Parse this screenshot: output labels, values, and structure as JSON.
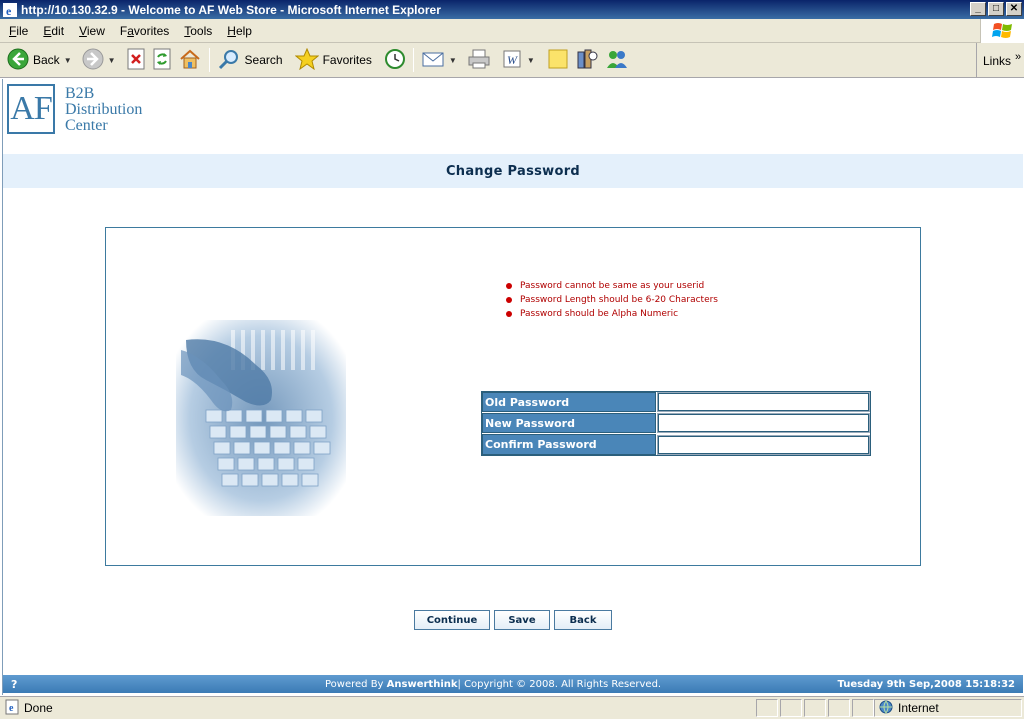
{
  "window": {
    "title": "http://10.130.32.9 - Welcome to AF Web Store - Microsoft Internet Explorer",
    "controls": {
      "minimize": "_",
      "maximize": "□",
      "close": "✕"
    }
  },
  "menubar": {
    "items": [
      {
        "accel": "F",
        "rest": "ile"
      },
      {
        "accel": "E",
        "rest": "dit"
      },
      {
        "accel": "V",
        "rest": "iew"
      },
      {
        "pre": "F",
        "accel": "a",
        "rest": "vorites"
      },
      {
        "accel": "T",
        "rest": "ools"
      },
      {
        "accel": "H",
        "rest": "elp"
      }
    ]
  },
  "toolbar": {
    "back_label": "Back",
    "search_label": "Search",
    "favorites_label": "Favorites",
    "links_label": "Links",
    "links_chevron": "»"
  },
  "logo": {
    "mark": "AF",
    "line1": "B2B",
    "line2": "Distribution",
    "line3": "Center"
  },
  "page": {
    "title": "Change Password",
    "rules": [
      "Password cannot be same as your userid",
      "Password Length should be 6-20 Characters",
      "Password should be Alpha Numeric"
    ],
    "fields": {
      "old_label": "Old Password",
      "old_value": "",
      "new_label": "New Password",
      "new_value": "",
      "confirm_label": "Confirm Password",
      "confirm_value": ""
    },
    "buttons": {
      "continue": "Continue",
      "save": "Save",
      "back": "Back"
    }
  },
  "footer": {
    "help": "?",
    "powered_prefix": "Powered By ",
    "powered_brand": "Answerthink",
    "copyright": "| Copyright © 2008. All Rights Reserved.",
    "datetime": "Tuesday 9th Sep,2008 15:18:32"
  },
  "statusbar": {
    "status": "Done",
    "zone": "Internet"
  },
  "colors": {
    "accent": "#3a79a8",
    "header_band": "#e4f0fb",
    "label_bg": "#4a86b8",
    "rule_text": "#b00000",
    "footer_bg": "#3b7bb5"
  }
}
